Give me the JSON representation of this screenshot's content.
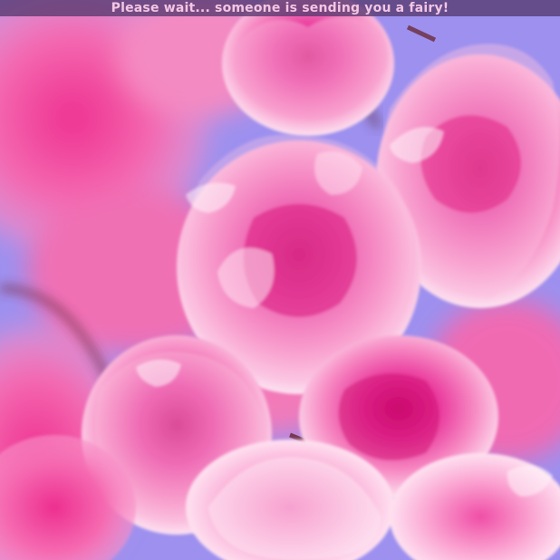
{
  "banner": {
    "message": "Please wait... someone is sending you a fairy!",
    "text_color": "#f4c6e4",
    "background_color": "#56386e"
  },
  "photo": {
    "subject": "pink-cherry-blossom-flowers",
    "palette": {
      "sky": "#9b8ff0",
      "petal_light": "#fbd7ec",
      "petal_mid": "#f57ab8",
      "petal_deep": "#e0147a",
      "branch": "#6b2a3a"
    }
  }
}
